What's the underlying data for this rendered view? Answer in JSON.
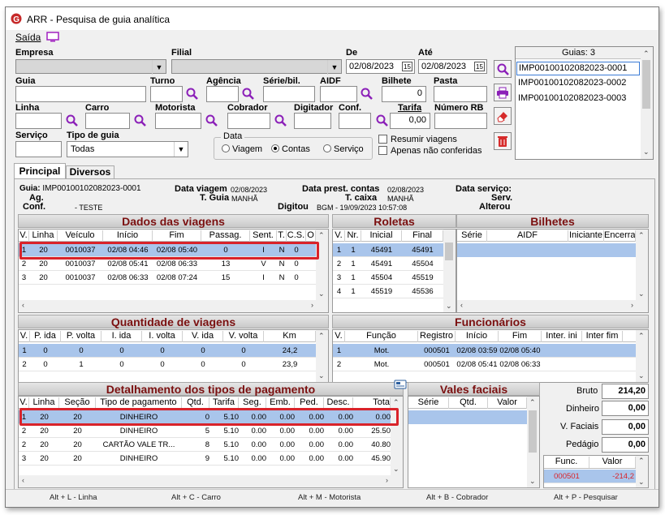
{
  "window": {
    "title": "ARR - Pesquisa de guia analítica"
  },
  "menu": {
    "exit": "Saída"
  },
  "filters": {
    "empresa_label": "Empresa",
    "filial_label": "Filial",
    "de_label": "De",
    "de_value": "02/08/2023",
    "ate_label": "Até",
    "ate_value": "02/08/2023",
    "cal_glyph": "15",
    "guia_label": "Guia",
    "turno_label": "Turno",
    "agencia_label": "Agência",
    "serie_label": "Série/bil.",
    "aidf_label": "AIDF",
    "bilhete_label": "Bilhete",
    "bilhete_value": "0",
    "pasta_label": "Pasta",
    "linha_label": "Linha",
    "carro_label": "Carro",
    "motorista_label": "Motorista",
    "cobrador_label": "Cobrador",
    "digitador_label": "Digitador",
    "conf_label": "Conf.",
    "tarifa_label": "Tarifa",
    "tarifa_value": "0,00",
    "numero_rb_label": "Número RB",
    "servico_label": "Serviço",
    "tipo_guia_label": "Tipo de guia",
    "tipo_guia_value": "Todas",
    "data_group": "Data",
    "opt_viagem": "Viagem",
    "opt_contas": "Contas",
    "opt_servico": "Serviço",
    "resumir": "Resumir viagens",
    "apenas": "Apenas não conferidas"
  },
  "guias": {
    "header": "Guias: 3",
    "items": [
      "IMP00100102082023-0001",
      "IMP00100102082023-0002",
      "IMP00100102082023-0003"
    ]
  },
  "tabs": [
    "Principal",
    "Diversos"
  ],
  "info": {
    "guia_label": "Guia:",
    "guia_value": "IMP00100102082023-0001",
    "data_viagem_label": "Data viagem",
    "data_viagem_value": "02/08/2023",
    "data_prest_label": "Data prest. contas",
    "data_prest_value": "02/08/2023",
    "data_servico_label": "Data serviço:",
    "ag_label": "Ag.",
    "tguia_label": "T. Guia",
    "tguia_value": "MANHÃ",
    "tcaixa_label": "T. caixa",
    "tcaixa_value": "MANHÃ",
    "serv_label": "Serv.",
    "conf_label": "Conf.",
    "conf_value": "- TESTE",
    "digitou_label": "Digitou",
    "digitou_value": "BGM - 19/09/2023 10:57:08",
    "alterou_label": "Alterou"
  },
  "viagens": {
    "title": "Dados das viagens",
    "cols": [
      "V.",
      "Linha",
      "Veículo",
      "Início",
      "Fim",
      "Passag.",
      "Sent.",
      "T.",
      "C.S.",
      "O"
    ],
    "rows": [
      [
        "1",
        "20",
        "0010037",
        "02/08 04:46",
        "02/08 05:40",
        "0",
        "I",
        "N",
        "0"
      ],
      [
        "2",
        "20",
        "0010037",
        "02/08 05:41",
        "02/08 06:33",
        "13",
        "V",
        "N",
        "0"
      ],
      [
        "3",
        "20",
        "0010037",
        "02/08 06:33",
        "02/08 07:24",
        "15",
        "I",
        "N",
        "0"
      ]
    ]
  },
  "roletas": {
    "title": "Roletas",
    "cols": [
      "V.",
      "Nr.",
      "Inicial",
      "Final"
    ],
    "rows": [
      [
        "1",
        "1",
        "45491",
        "45491"
      ],
      [
        "2",
        "1",
        "45491",
        "45504"
      ],
      [
        "3",
        "1",
        "45504",
        "45519"
      ],
      [
        "4",
        "1",
        "45519",
        "45536"
      ]
    ]
  },
  "bilhetes": {
    "title": "Bilhetes",
    "cols": [
      "Série",
      "AIDF",
      "Iniciante",
      "Encerrar"
    ]
  },
  "qtd": {
    "title": "Quantidade de viagens",
    "cols": [
      "V.",
      "P. ida",
      "P. volta",
      "I. ida",
      "I. volta",
      "V. ida",
      "V. volta",
      "Km"
    ],
    "rows": [
      [
        "1",
        "0",
        "0",
        "0",
        "0",
        "0",
        "0",
        "24,2"
      ],
      [
        "2",
        "0",
        "1",
        "0",
        "0",
        "0",
        "0",
        "23,9"
      ]
    ]
  },
  "func": {
    "title": "Funcionários",
    "cols": [
      "V.",
      "Função",
      "Registro",
      "Início",
      "Fim",
      "Inter. ini",
      "Inter fim"
    ],
    "rows": [
      [
        "1",
        "Mot.",
        "000501",
        "02/08 03:59",
        "02/08 05:40"
      ],
      [
        "2",
        "Mot.",
        "000501",
        "02/08 05:41",
        "02/08 06:33"
      ]
    ]
  },
  "pag": {
    "title": "Detalhamento dos tipos de pagamento",
    "cols": [
      "V.",
      "Linha",
      "Seção",
      "Tipo de pagamento",
      "Qtd.",
      "Tarifa",
      "Seg.",
      "Emb.",
      "Ped.",
      "Desc.",
      "Tota"
    ],
    "rows": [
      [
        "1",
        "20",
        "20",
        "DINHEIRO",
        "0",
        "5.10",
        "0.00",
        "0.00",
        "0.00",
        "0.00",
        "0.00"
      ],
      [
        "2",
        "20",
        "20",
        "DINHEIRO",
        "5",
        "5.10",
        "0.00",
        "0.00",
        "0.00",
        "0.00",
        "25.50"
      ],
      [
        "2",
        "20",
        "20",
        "CARTÃO VALE TR...",
        "8",
        "5.10",
        "0.00",
        "0.00",
        "0.00",
        "0.00",
        "40.80"
      ],
      [
        "3",
        "20",
        "20",
        "DINHEIRO",
        "9",
        "5.10",
        "0.00",
        "0.00",
        "0.00",
        "0.00",
        "45.90"
      ]
    ]
  },
  "vales": {
    "title": "Vales faciais",
    "cols": [
      "Série",
      "Qtd.",
      "Valor"
    ]
  },
  "totais": {
    "bruto_label": "Bruto",
    "bruto_value": "214,20",
    "dinheiro_label": "Dinheiro",
    "dinheiro_value": "0,00",
    "vfaciais_label": "V. Faciais",
    "vfaciais_value": "0,00",
    "pedagio_label": "Pedágio",
    "pedagio_value": "0,00",
    "func_col": "Func.",
    "valor_col": "Valor",
    "func_value": "000501",
    "valor_value": "-214,2"
  },
  "shortcuts": [
    "Alt + L - Linha",
    "Alt + C - Carro",
    "Alt + M - Motorista",
    "Alt + B - Cobrador",
    "Alt + P - Pesquisar"
  ],
  "colors": {
    "sectionTitle": "#7b1010",
    "selection": "#a9c5eb",
    "highlight": "#d9232a",
    "logo": "#c62828"
  }
}
